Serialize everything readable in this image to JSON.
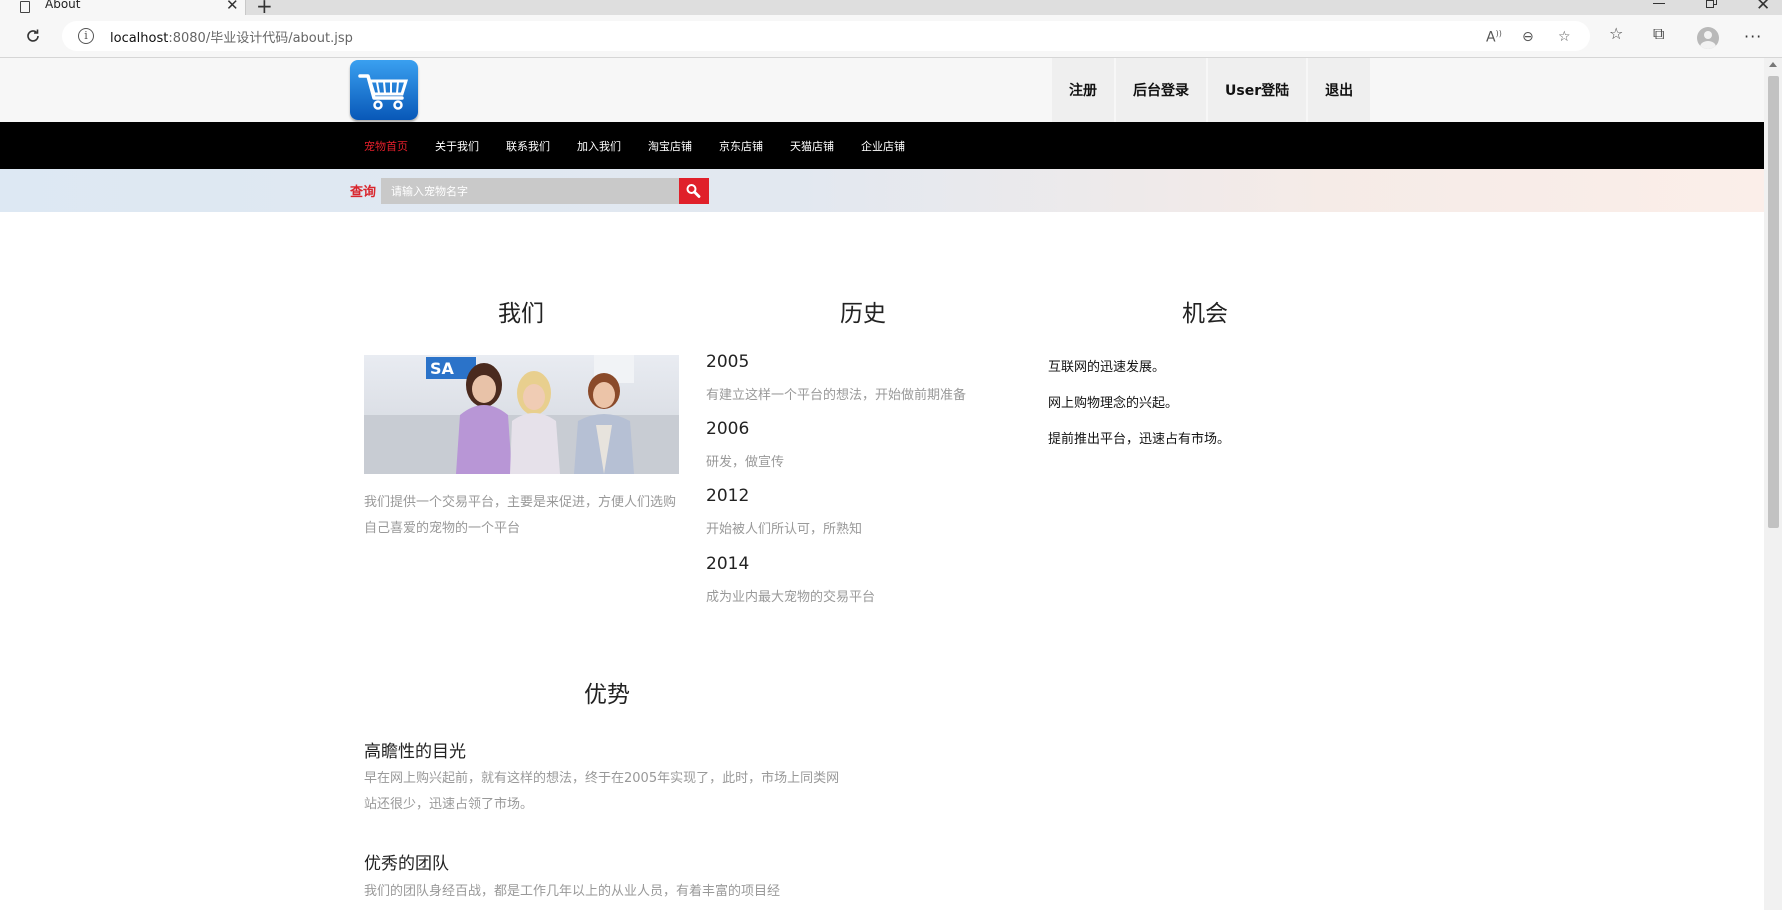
{
  "browser": {
    "tab_title": "About",
    "url_host": "localhost",
    "url_rest": ":8080/毕业设计代码/about.jsp"
  },
  "header": {
    "links": [
      "注册",
      "后台登录",
      "User登陆",
      "退出"
    ]
  },
  "nav": {
    "items": [
      "宠物首页",
      "关于我们",
      "联系我们",
      "加入我们",
      "淘宝店铺",
      "京东店铺",
      "天猫店铺",
      "企业店铺"
    ],
    "active_index": 0
  },
  "search": {
    "label": "查询",
    "placeholder": "请输入宠物名字"
  },
  "about": {
    "we_title": "我们",
    "we_text": "我们提供一个交易平台，主要是来促进，方便人们选购自己喜爱的宠物的一个平台",
    "history_title": "历史",
    "history": [
      {
        "year": "2005",
        "desc": "有建立这样一个平台的想法，开始做前期准备"
      },
      {
        "year": "2006",
        "desc": "研发，做宣传"
      },
      {
        "year": "2012",
        "desc": "开始被人们所认可，所熟知"
      },
      {
        "year": "2014",
        "desc": "成为业内最大宠物的交易平台"
      }
    ],
    "chance_title": "机会",
    "chances": [
      "互联网的迅速发展。",
      "网上购物理念的兴起。",
      "提前推出平台，迅速占有市场。"
    ]
  },
  "advantages": {
    "title": "优势",
    "items": [
      {
        "heading": "高瞻性的目光",
        "text": "早在网上购兴起前，就有这样的想法，终于在2005年实现了，此时，市场上同类网站还很少，迅速占领了市场。"
      },
      {
        "heading": "优秀的团队",
        "text": "我们的团队身经百战，都是工作几年以上的从业人员，有着丰富的项目经"
      }
    ]
  },
  "colors": {
    "accent_red": "#e0202a",
    "nav_bg": "#000000",
    "logo_blue": "#1a7ad8"
  }
}
